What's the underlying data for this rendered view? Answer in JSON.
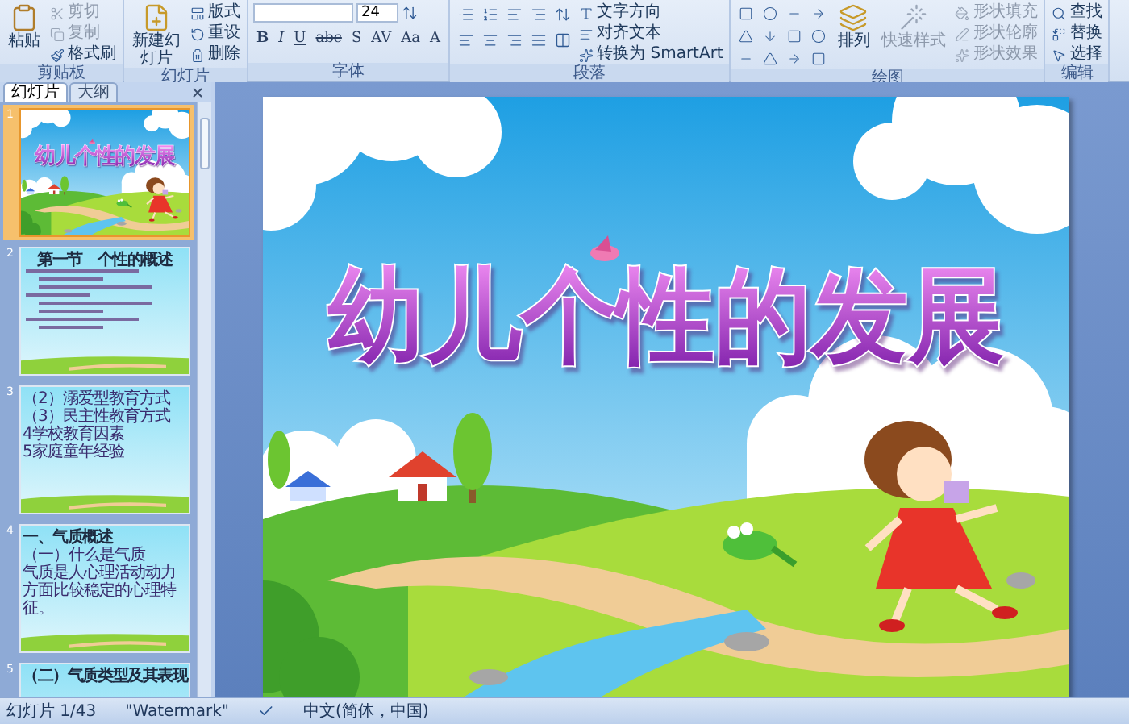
{
  "ribbon": {
    "groups": [
      {
        "kind": "clipboard",
        "label": "剪贴板",
        "main": "粘贴",
        "items": [
          {
            "label": "剪切",
            "disabled": true
          },
          {
            "label": "复制",
            "disabled": true
          },
          {
            "label": "格式刷",
            "disabled": false
          }
        ]
      },
      {
        "kind": "slides",
        "label": "幻灯片",
        "main": "新建幻灯片",
        "items": [
          {
            "label": "版式",
            "disabled": false
          },
          {
            "label": "重设",
            "disabled": false
          },
          {
            "label": "删除",
            "disabled": false
          }
        ]
      },
      {
        "kind": "font",
        "label": "字体",
        "font_size": "24",
        "format_buttons": [
          "B",
          "I",
          "U",
          "abc",
          "S",
          "AV",
          "Aa",
          "A"
        ]
      },
      {
        "kind": "paragraph",
        "label": "段落",
        "items": [
          {
            "label": "文字方向",
            "disabled": false
          },
          {
            "label": "对齐文本",
            "disabled": false
          },
          {
            "label": "转换为 SmartArt",
            "disabled": false
          }
        ]
      },
      {
        "kind": "drawing",
        "label": "绘图",
        "buttons": [
          {
            "label": "排列",
            "disabled": false
          },
          {
            "label": "快速样式",
            "disabled": true
          }
        ],
        "items": [
          {
            "label": "形状填充",
            "disabled": true
          },
          {
            "label": "形状轮廓",
            "disabled": true
          },
          {
            "label": "形状效果",
            "disabled": true
          }
        ]
      },
      {
        "kind": "editing",
        "label": "编辑",
        "items": [
          {
            "label": "查找",
            "disabled": false
          },
          {
            "label": "替换",
            "disabled": false
          },
          {
            "label": "选择",
            "disabled": false
          }
        ]
      }
    ]
  },
  "panel": {
    "tabs": [
      {
        "label": "幻灯片",
        "selected": true
      },
      {
        "label": "大纲",
        "selected": false
      }
    ],
    "slides": [
      {
        "number": "1",
        "kind": "title",
        "selected": true,
        "title": "幼儿个性的发展"
      },
      {
        "number": "2",
        "kind": "outline",
        "selected": false,
        "title": "第一节　个性的概述"
      },
      {
        "number": "3",
        "kind": "bullets",
        "selected": false,
        "bullets": [
          "（2）溺爱型教育方式",
          "（3）民主性教育方式",
          "4学校教育因素",
          "5家庭童年经验"
        ]
      },
      {
        "number": "4",
        "kind": "bullets",
        "selected": false,
        "title": "一、气质概述",
        "bullets": [
          "（一）什么是气质",
          "气质是人心理活动动力方面比较稳定的心理特征。"
        ]
      },
      {
        "number": "5",
        "kind": "bullets",
        "selected": false,
        "title": "（二）气质类型及其表现"
      }
    ]
  },
  "slide": {
    "title": "幼儿个性的发展"
  },
  "status_bar": {
    "slide_info": "幻灯片 1/43",
    "theme": "\"Watermark\"",
    "language": "中文(简体，中国)"
  }
}
